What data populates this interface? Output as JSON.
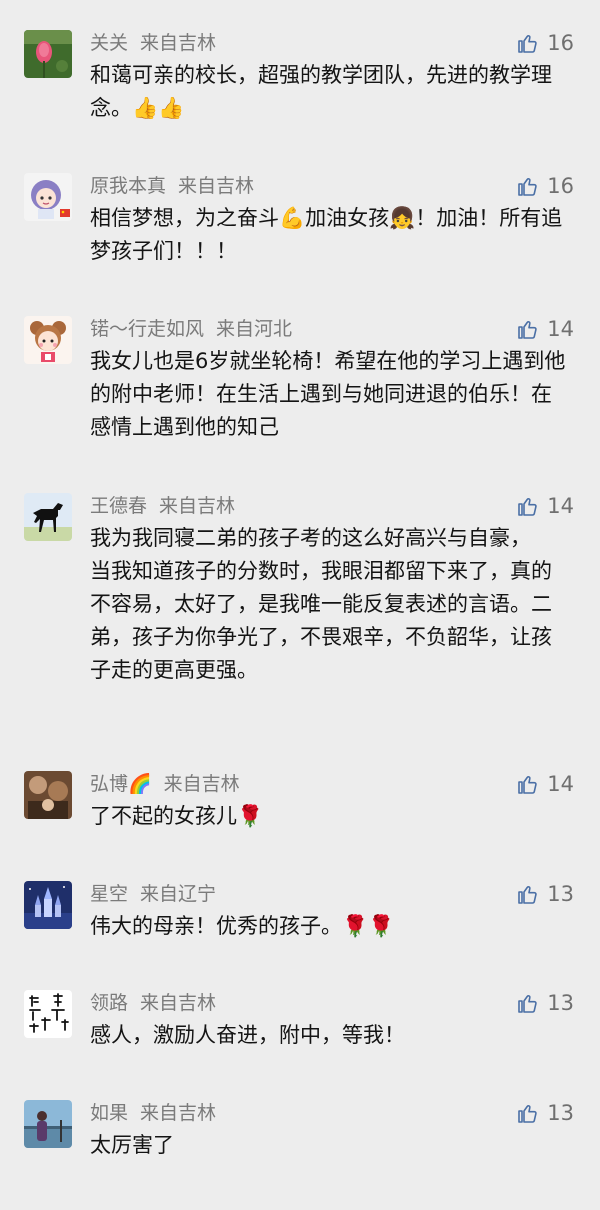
{
  "comments": [
    {
      "name": "关关",
      "location": "来自吉林",
      "likes": "16",
      "text": "和蔼可亲的校长，超强的教学团队，先进的教学理念。👍👍",
      "avatar": "pink-flower-avatar"
    },
    {
      "name": "原我本真",
      "location": "来自吉林",
      "likes": "16",
      "text": "相信梦想，为之奋斗💪加油女孩👧！加油！所有追梦孩子们！！！",
      "avatar": "cartoon-girl-avatar"
    },
    {
      "name": "锘～行走如风",
      "location": "来自河北",
      "likes": "14",
      "text": "我女儿也是6岁就坐轮椅！希望在他的学习上遇到他的附中老师！在生活上遇到与她同进退的伯乐！在感情上遇到他的知己",
      "avatar": "cartoon-doll-avatar"
    },
    {
      "name": "王德春",
      "location": "来自吉林",
      "likes": "14",
      "text": "我为我同寝二弟的孩子考的这么好高兴与自豪，\n当我知道孩子的分数时，我眼泪都留下来了，真的不容易，太好了，是我唯一能反复表述的言语。二弟，孩子为你争光了，不畏艰辛，不负韶华，让孩子走的更高更强。",
      "avatar": "black-horse-avatar"
    },
    {
      "name": "弘博🌈",
      "location": "来自吉林",
      "likes": "14",
      "text": "了不起的女孩儿🌹",
      "avatar": "photo-avatar"
    },
    {
      "name": "星空",
      "location": "来自辽宁",
      "likes": "13",
      "text": "伟大的母亲！优秀的孩子。🌹🌹",
      "avatar": "castle-night-avatar"
    },
    {
      "name": "领路",
      "location": "来自吉林",
      "likes": "13",
      "text": "感人，激励人奋进，附中，等我！",
      "avatar": "calligraphy-avatar"
    },
    {
      "name": "如果",
      "location": "来自吉林",
      "likes": "13",
      "text": "太厉害了",
      "avatar": "person-photo-avatar"
    }
  ],
  "colors": {
    "background": "#ededed",
    "meta_text": "#7b7b7b",
    "body_text": "#141414",
    "like_icon": "#4a6fa5"
  }
}
